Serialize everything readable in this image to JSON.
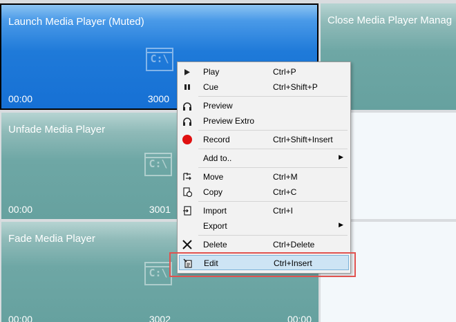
{
  "tiles": [
    {
      "title": "Launch Media Player (Muted)",
      "time": "00:00",
      "number": "3000"
    },
    {
      "title": "Close Media Player Manag"
    },
    {
      "title": "Unfade Media Player",
      "time": "00:00",
      "number": "3001"
    },
    {
      "title": "Fade Media Player",
      "time": "00:00",
      "number": "3002",
      "right": "00:00"
    }
  ],
  "tile_icon_text": "C:\\",
  "context_menu": {
    "play": {
      "label": "Play",
      "shortcut": "Ctrl+P"
    },
    "cue": {
      "label": "Cue",
      "shortcut": "Ctrl+Shift+P"
    },
    "preview": {
      "label": "Preview"
    },
    "preview_extro": {
      "label": "Preview Extro"
    },
    "record": {
      "label": "Record",
      "shortcut": "Ctrl+Shift+Insert"
    },
    "add_to": {
      "label": "Add to.."
    },
    "move": {
      "label": "Move",
      "shortcut": "Ctrl+M"
    },
    "copy": {
      "label": "Copy",
      "shortcut": "Ctrl+C"
    },
    "import": {
      "label": "Import",
      "shortcut": "Ctrl+I"
    },
    "export": {
      "label": "Export"
    },
    "delete": {
      "label": "Delete",
      "shortcut": "Ctrl+Delete"
    },
    "edit": {
      "label": "Edit",
      "shortcut": "Ctrl+Insert"
    }
  },
  "icons": {
    "play": "play-icon",
    "cue": "pause-icon",
    "preview": "headphones-icon",
    "preview_extro": "headphones-icon",
    "record": "record-icon",
    "move": "move-icon",
    "copy": "copy-icon",
    "import": "import-icon",
    "delete": "close-icon",
    "edit": "edit-icon",
    "submenu": "chevron-right-icon"
  },
  "colors": {
    "selected_tile": "#1f7ad9",
    "tile": "#6ea7a5",
    "record": "#e01010",
    "highlight": "#cde4f4",
    "annotation": "#e0524f"
  }
}
